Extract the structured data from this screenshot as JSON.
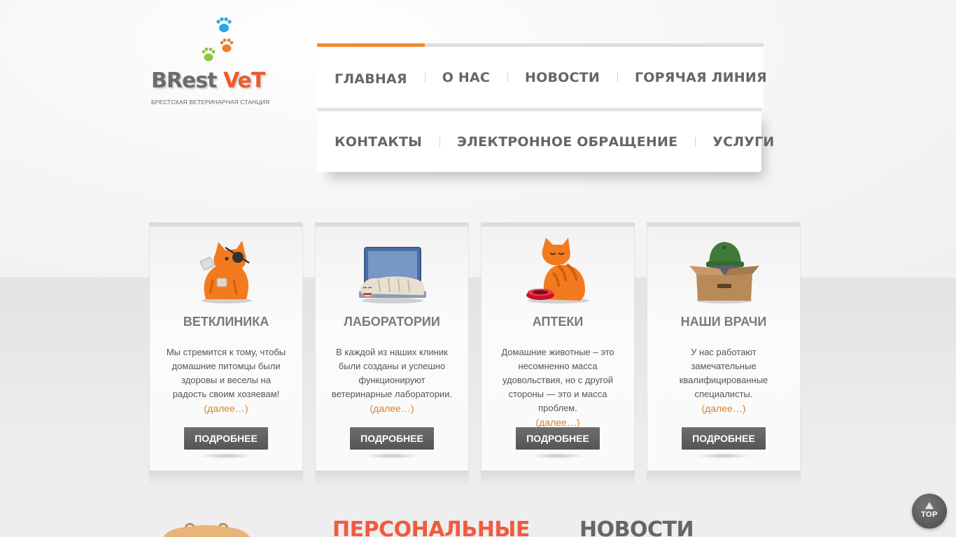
{
  "logo": {
    "word_1": "BRest",
    "word_2": "VeT",
    "subtitle": "Брестская ветеринарная станция"
  },
  "nav": {
    "row1": [
      {
        "label": "Главная",
        "active": true
      },
      {
        "label": "О нас"
      },
      {
        "label": "Новости"
      },
      {
        "label": "Горячая линия"
      }
    ],
    "row2": [
      {
        "label": "Контакты"
      },
      {
        "label": "Электронное обращение"
      },
      {
        "label": "Услуги"
      }
    ],
    "active_color": "#f48a2c"
  },
  "cards": [
    {
      "icon": "injured-cat-icon",
      "title": "Ветклиника",
      "text": "Мы стремится к тому, чтобы домашние питомцы были здоровы и веселы на радость своим хозяевам!",
      "more": "(далее…)",
      "button": "Подробнее"
    },
    {
      "icon": "cat-on-laptop-icon",
      "title": "Лаборатории",
      "text": "В каждой из наших клиник были созданы и успешно функционируют ветеринарные лаборатории.",
      "more": "(далее…)",
      "button": "Подробнее"
    },
    {
      "icon": "cat-with-bowl-icon",
      "title": "Аптеки",
      "text": "Домашние животные – это несомненно масса удовольствия, но с другой стороны — это и масса проблем.",
      "more": "(далее…)",
      "button": "Подробнее"
    },
    {
      "icon": "cat-in-box-icon",
      "title": "Наши врачи",
      "text": "У нас работают замечательные квалифицированные специалисты.",
      "more": "(далее…)",
      "button": "Подробнее"
    }
  ],
  "bottom": {
    "personal": "Персональные",
    "news": "Новости"
  },
  "top_button": {
    "label": "TOP"
  },
  "colors": {
    "accent_orange": "#f48a2c",
    "link_orange": "#d9822b",
    "heading_red": "#f15a40"
  }
}
